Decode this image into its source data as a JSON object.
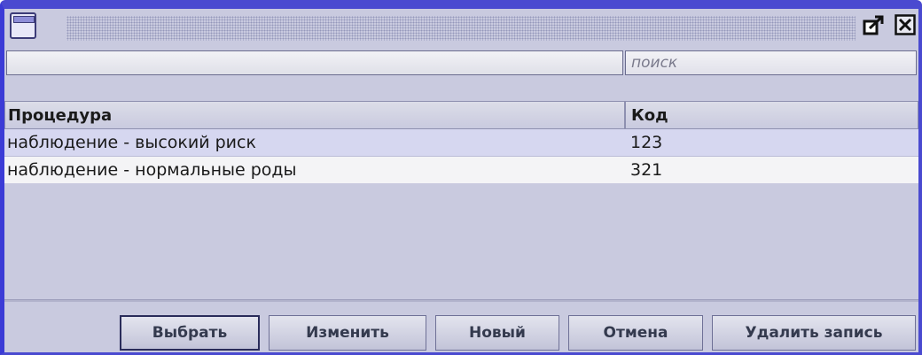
{
  "window": {
    "icon": "app-window-icon",
    "buttons": {
      "maximize": "maximize-icon",
      "close": "close-icon"
    }
  },
  "search": {
    "placeholder": "поиск",
    "value": ""
  },
  "table": {
    "columns": [
      "Процедура",
      "Код"
    ],
    "rows": [
      {
        "procedure": "наблюдение - высокий риск",
        "code": "123",
        "selected": true
      },
      {
        "procedure": "наблюдение - нормальные роды",
        "code": "321",
        "selected": false
      }
    ]
  },
  "buttons": {
    "select": "Выбрать",
    "edit": "Изменить",
    "new": "Новый",
    "cancel": "Отмена",
    "delete": "Удалить запись"
  },
  "colors": {
    "frame": "#4a4ad0",
    "panel": "#c9cadf",
    "selected_row": "#d6d7f0"
  }
}
